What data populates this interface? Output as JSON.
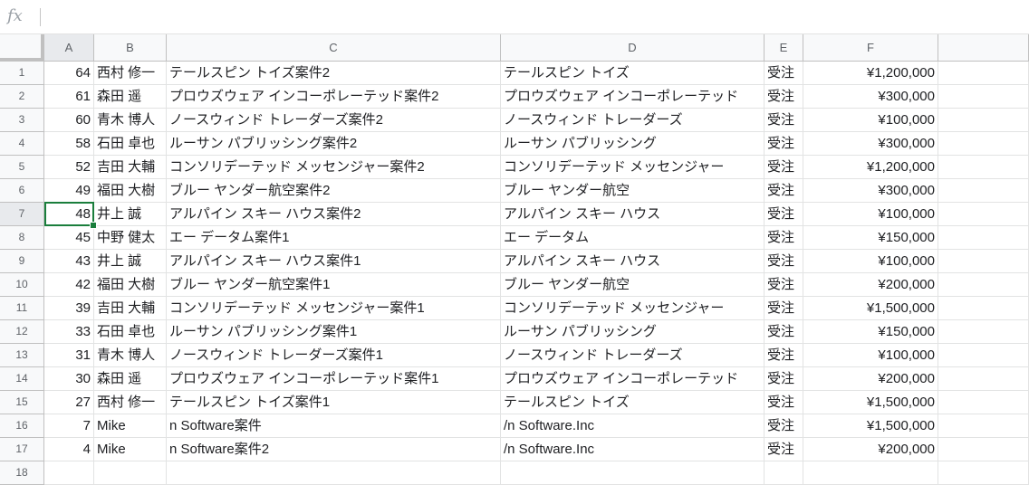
{
  "formula_bar": {
    "icon": "fx",
    "value": ""
  },
  "columns": [
    "A",
    "B",
    "C",
    "D",
    "E",
    "F"
  ],
  "rows": [
    {
      "n": "1",
      "a": "64",
      "b": "西村 修一",
      "c": "テールスピン トイズ案件2",
      "d": "テールスピン トイズ",
      "e": "受注",
      "f": "¥1,200,000"
    },
    {
      "n": "2",
      "a": "61",
      "b": "森田 遥",
      "c": "プロウズウェア インコーポレーテッド案件2",
      "d": "プロウズウェア インコーポレーテッド",
      "e": "受注",
      "f": "¥300,000"
    },
    {
      "n": "3",
      "a": "60",
      "b": "青木 博人",
      "c": "ノースウィンド トレーダーズ案件2",
      "d": "ノースウィンド トレーダーズ",
      "e": "受注",
      "f": "¥100,000"
    },
    {
      "n": "4",
      "a": "58",
      "b": "石田 卓也",
      "c": "ルーサン パブリッシング案件2",
      "d": "ルーサン パブリッシング",
      "e": "受注",
      "f": "¥300,000"
    },
    {
      "n": "5",
      "a": "52",
      "b": "吉田 大輔",
      "c": "コンソリデーテッド メッセンジャー案件2",
      "d": "コンソリデーテッド メッセンジャー",
      "e": "受注",
      "f": "¥1,200,000"
    },
    {
      "n": "6",
      "a": "49",
      "b": "福田 大樹",
      "c": "ブルー ヤンダー航空案件2",
      "d": "ブルー ヤンダー航空",
      "e": "受注",
      "f": "¥300,000"
    },
    {
      "n": "7",
      "a": "48",
      "b": "井上 誠",
      "c": "アルパイン スキー ハウス案件2",
      "d": "アルパイン スキー ハウス",
      "e": "受注",
      "f": "¥100,000"
    },
    {
      "n": "8",
      "a": "45",
      "b": "中野 健太",
      "c": "エー データム案件1",
      "d": "エー データム",
      "e": "受注",
      "f": "¥150,000"
    },
    {
      "n": "9",
      "a": "43",
      "b": "井上 誠",
      "c": "アルパイン スキー ハウス案件1",
      "d": "アルパイン スキー ハウス",
      "e": "受注",
      "f": "¥100,000"
    },
    {
      "n": "10",
      "a": "42",
      "b": "福田 大樹",
      "c": "ブルー ヤンダー航空案件1",
      "d": "ブルー ヤンダー航空",
      "e": "受注",
      "f": "¥200,000"
    },
    {
      "n": "11",
      "a": "39",
      "b": "吉田 大輔",
      "c": "コンソリデーテッド メッセンジャー案件1",
      "d": "コンソリデーテッド メッセンジャー",
      "e": "受注",
      "f": "¥1,500,000"
    },
    {
      "n": "12",
      "a": "33",
      "b": "石田 卓也",
      "c": "ルーサン パブリッシング案件1",
      "d": "ルーサン パブリッシング",
      "e": "受注",
      "f": "¥150,000"
    },
    {
      "n": "13",
      "a": "31",
      "b": "青木 博人",
      "c": "ノースウィンド トレーダーズ案件1",
      "d": "ノースウィンド トレーダーズ",
      "e": "受注",
      "f": "¥100,000"
    },
    {
      "n": "14",
      "a": "30",
      "b": "森田 遥",
      "c": "プロウズウェア インコーポレーテッド案件1",
      "d": "プロウズウェア インコーポレーテッド",
      "e": "受注",
      "f": "¥200,000"
    },
    {
      "n": "15",
      "a": "27",
      "b": "西村 修一",
      "c": "テールスピン トイズ案件1",
      "d": "テールスピン トイズ",
      "e": "受注",
      "f": "¥1,500,000"
    },
    {
      "n": "16",
      "a": "7",
      "b": "Mike",
      "c": "n Software案件",
      "d": "/n Software.Inc",
      "e": "受注",
      "f": "¥1,500,000"
    },
    {
      "n": "17",
      "a": "4",
      "b": "Mike",
      "c": "n Software案件2",
      "d": "/n Software.Inc",
      "e": "受注",
      "f": "¥200,000"
    },
    {
      "n": "18",
      "a": "",
      "b": "",
      "c": "",
      "d": "",
      "e": "",
      "f": ""
    }
  ],
  "active_cell": {
    "row": "7",
    "column": "A"
  },
  "colors": {
    "selection": "#1a7e3c",
    "header_bg": "#f8f9fa",
    "gridline": "#e2e3e3"
  }
}
